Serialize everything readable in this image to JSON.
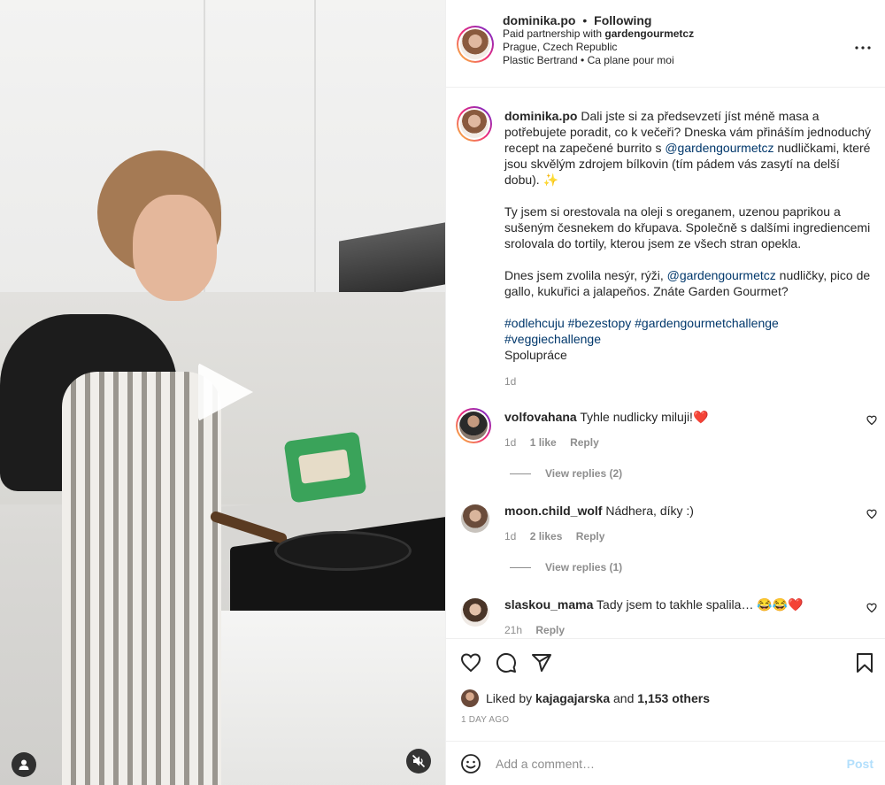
{
  "header": {
    "username": "dominika.po",
    "dot": "•",
    "follow_status": "Following",
    "partnership_prefix": "Paid partnership with",
    "partner": "gardengourmetcz",
    "location": "Prague, Czech Republic",
    "audio": "Plastic Bertrand • Ca plane pour moi",
    "more_icon": "more-icon"
  },
  "caption": {
    "username": "dominika.po",
    "p1_a": " Dali jste si za předsevzetí jíst méně masa a potřebujete poradit, co k večeři? Dneska vám přináším jednoduchý recept na zapečené burrito s ",
    "p1_mention": "@gardengourmetcz",
    "p1_b": " nudličkami, které jsou skvělým zdrojem bílkovin (tím pádem vás zasytí na delší dobu). ✨",
    "p2": "Ty jsem si orestovala na oleji s oreganem, uzenou paprikou a sušeným česnekem do křupava. Společně s dalšími ingrediencemi srolovala do tortily, kterou jsem ze všech stran opekla.",
    "p3_a": "Dnes jsem zvolila nesýr, rýži, ",
    "p3_mention": "@gardengourmetcz",
    "p3_b": " nudličky, pico de gallo, kukuřici a jalapeňos. Znáte Garden Gourmet?",
    "tag1": "#odlehcuju",
    "tag2": "#bezestopy",
    "tag3": "#gardengourmetchallenge",
    "tag4": "#veggiechallenge",
    "collab": "Spolupráce",
    "time": "1d"
  },
  "comments": [
    {
      "username": "volfovahana",
      "text": " Tyhle nudlicky miluji!❤️",
      "time": "1d",
      "likes": "1 like",
      "reply": "Reply",
      "view_replies": "View replies (2)"
    },
    {
      "username": "moon.child_wolf",
      "text": " Nádhera, díky :)",
      "time": "1d",
      "likes": "2 likes",
      "reply": "Reply",
      "view_replies": "View replies (1)"
    },
    {
      "username": "slaskou_mama",
      "text": " Tady jsem to takhle spalila… 😂😂❤️",
      "time": "21h",
      "reply": "Reply"
    }
  ],
  "actions": {
    "liked_prefix": "Liked by",
    "liked_user": "kajagajarska",
    "liked_and": "and",
    "liked_count": "1,153 others",
    "time_ago": "1 DAY AGO"
  },
  "add_comment": {
    "placeholder": "Add a comment…",
    "post": "Post"
  },
  "colors": {
    "link": "#00376b",
    "muted": "#8e8e8e",
    "post_disabled": "#b2dffc",
    "heart_red": "#ed4956"
  }
}
